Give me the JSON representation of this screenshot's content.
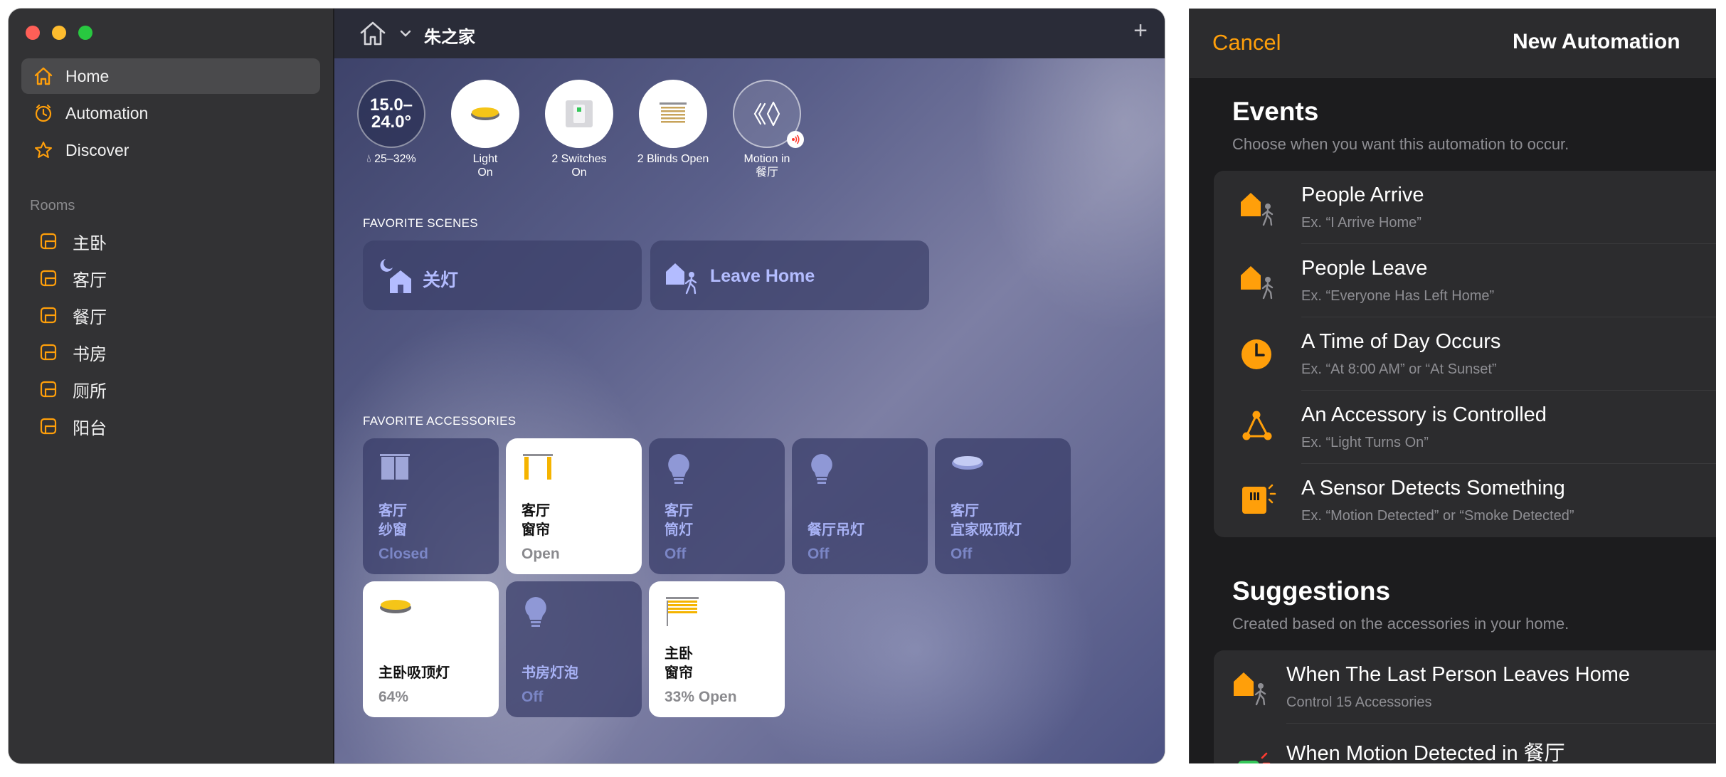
{
  "sidebar": {
    "nav": [
      {
        "label": "Home",
        "icon": "house-icon",
        "active": true
      },
      {
        "label": "Automation",
        "icon": "clock-icon",
        "active": false
      },
      {
        "label": "Discover",
        "icon": "star-icon",
        "active": false
      }
    ],
    "rooms_title": "Rooms",
    "rooms": [
      "主卧",
      "客厅",
      "餐厅",
      "书房",
      "厕所",
      "阳台"
    ]
  },
  "topbar": {
    "home_name": "朱之家",
    "add_label": "+"
  },
  "status": {
    "temp_range_line1": "15.0–",
    "temp_range_line2": "24.0°",
    "humidity": "25–32%",
    "light": {
      "line1": "Light",
      "line2": "On"
    },
    "switches": {
      "line1": "2 Switches",
      "line2": "On"
    },
    "blinds": {
      "line1": "2 Blinds Open"
    },
    "motion": {
      "line1": "Motion in",
      "line2": "餐厅"
    }
  },
  "scenes": {
    "title": "FAVORITE SCENES",
    "items": [
      {
        "label": "关灯"
      },
      {
        "label": "Leave Home"
      }
    ]
  },
  "accessories": {
    "title": "FAVORITE ACCESSORIES",
    "items": [
      {
        "room": "客厅",
        "name": "纱窗",
        "state": "Closed",
        "on": false
      },
      {
        "room": "客厅",
        "name": "窗帘",
        "state": "Open",
        "on": true
      },
      {
        "room": "客厅",
        "name": "筒灯",
        "state": "Off",
        "on": false
      },
      {
        "room": "",
        "name": "餐厅吊灯",
        "state": "Off",
        "on": false
      },
      {
        "room": "客厅",
        "name": "宜家吸顶灯",
        "state": "Off",
        "on": false
      },
      {
        "room": "",
        "name": "主卧吸顶灯",
        "state": "64%",
        "on": true
      },
      {
        "room": "",
        "name": "书房灯泡",
        "state": "Off",
        "on": false
      },
      {
        "room": "主卧",
        "name": "窗帘",
        "state": "33% Open",
        "on": true
      }
    ]
  },
  "automation": {
    "cancel": "Cancel",
    "title": "New Automation",
    "events_heading": "Events",
    "events_sub": "Choose when you want this automation to occur.",
    "events": [
      {
        "title": "People Arrive",
        "sub": "Ex. “I Arrive Home”",
        "icon": "person-arrive-icon"
      },
      {
        "title": "People Leave",
        "sub": "Ex. “Everyone Has Left Home”",
        "icon": "person-leave-icon"
      },
      {
        "title": "A Time of Day Occurs",
        "sub": "Ex. “At 8:00 AM” or “At Sunset”",
        "icon": "clock-icon"
      },
      {
        "title": "An Accessory is Controlled",
        "sub": "Ex. “Light Turns On”",
        "icon": "accessory-icon"
      },
      {
        "title": "A Sensor Detects Something",
        "sub": "Ex. “Motion Detected” or “Smoke Detected”",
        "icon": "sensor-icon"
      }
    ],
    "suggestions_heading": "Suggestions",
    "suggestions_sub": "Created based on the accessories in your home.",
    "suggestions": [
      {
        "title": "When The Last Person Leaves Home",
        "sub": "Control 15 Accessories"
      },
      {
        "title": "When Motion Detected in 餐厅",
        "sub": ""
      }
    ]
  },
  "colors": {
    "accent_orange": "#ff9f0a",
    "scene_text": "#b3bcff",
    "sidebar_bg": "#323234"
  }
}
